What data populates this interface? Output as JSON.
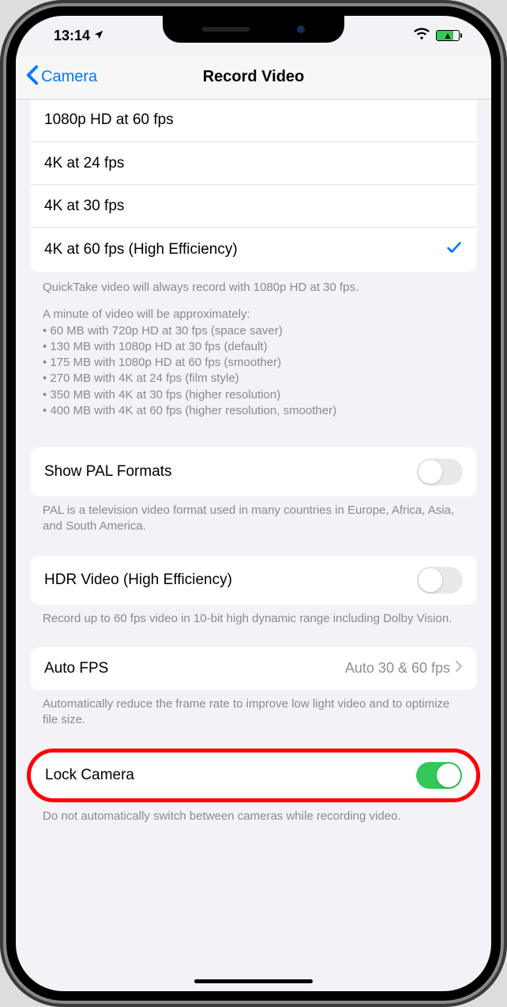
{
  "status": {
    "time": "13:14"
  },
  "nav": {
    "back_label": "Camera",
    "title": "Record Video"
  },
  "resolutions": [
    {
      "label": "1080p HD at 60 fps",
      "selected": false
    },
    {
      "label": "4K at 24 fps",
      "selected": false
    },
    {
      "label": "4K at 30 fps",
      "selected": false
    },
    {
      "label": "4K at 60 fps (High Efficiency)",
      "selected": true
    }
  ],
  "footer_quicktake": "QuickTake video will always record with 1080p HD at 30 fps.",
  "footer_sizes_intro": "A minute of video will be approximately:",
  "footer_sizes": [
    "• 60 MB with 720p HD at 30 fps (space saver)",
    "• 130 MB with 1080p HD at 30 fps (default)",
    "• 175 MB with 1080p HD at 60 fps (smoother)",
    "• 270 MB with 4K at 24 fps (film style)",
    "• 350 MB with 4K at 30 fps (higher resolution)",
    "• 400 MB with 4K at 60 fps (higher resolution, smoother)"
  ],
  "pal": {
    "label": "Show PAL Formats",
    "on": false,
    "footer": "PAL is a television video format used in many countries in Europe, Africa, Asia, and South America."
  },
  "hdr": {
    "label": "HDR Video (High Efficiency)",
    "on": false,
    "footer": "Record up to 60 fps video in 10-bit high dynamic range including Dolby Vision."
  },
  "autofps": {
    "label": "Auto FPS",
    "value": "Auto 30 & 60 fps",
    "footer": "Automatically reduce the frame rate to improve low light video and to optimize file size."
  },
  "lockcamera": {
    "label": "Lock Camera",
    "on": true,
    "footer": "Do not automatically switch between cameras while recording video."
  }
}
